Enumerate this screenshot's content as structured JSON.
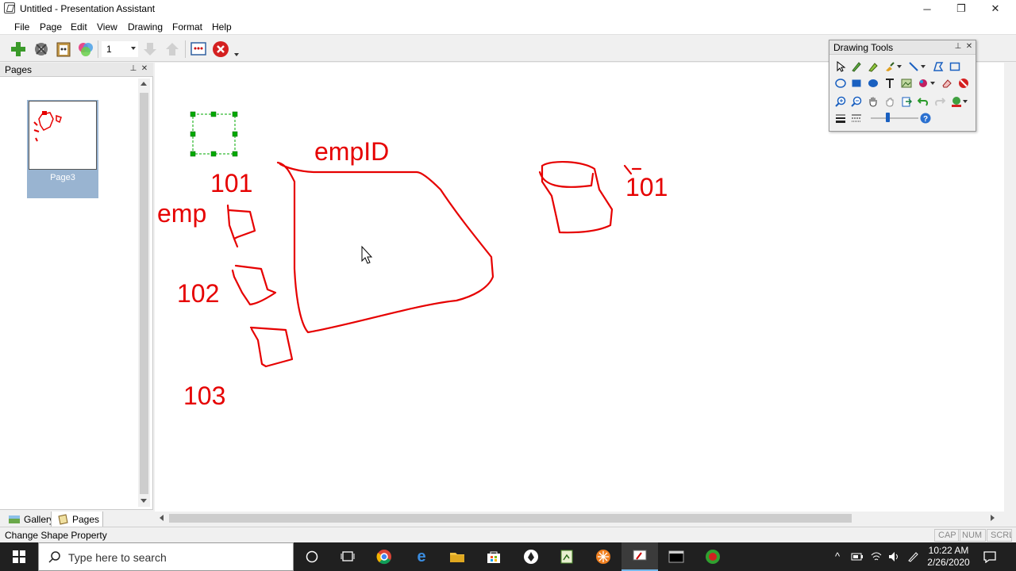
{
  "window": {
    "title": "Untitled - Presentation Assistant",
    "minimize": "─",
    "maximize": "❐",
    "close": "✕"
  },
  "menu": [
    "File",
    "Page",
    "Edit",
    "View",
    "Drawing",
    "Format",
    "Help"
  ],
  "toolbar": {
    "page_number": "1"
  },
  "pages_panel": {
    "title": "Pages",
    "thumbnail_label": "Page3",
    "tabs": {
      "gallery": "Gallery",
      "pages": "Pages"
    }
  },
  "drawing_tools": {
    "title": "Drawing Tools"
  },
  "canvas": {
    "texts": {
      "empid": "empID",
      "n101_left": "101",
      "emp": "emp",
      "n102": "102",
      "n103": "103",
      "n101_right": "101"
    },
    "ink_color": "#e60000",
    "selection_color": "#00aa00"
  },
  "status": {
    "message": "Change Shape Property",
    "indicators": [
      "CAP",
      "NUM",
      "SCRL"
    ]
  },
  "taskbar": {
    "search_placeholder": "Type here to search",
    "time": "10:22 AM",
    "date": "2/26/2020"
  }
}
